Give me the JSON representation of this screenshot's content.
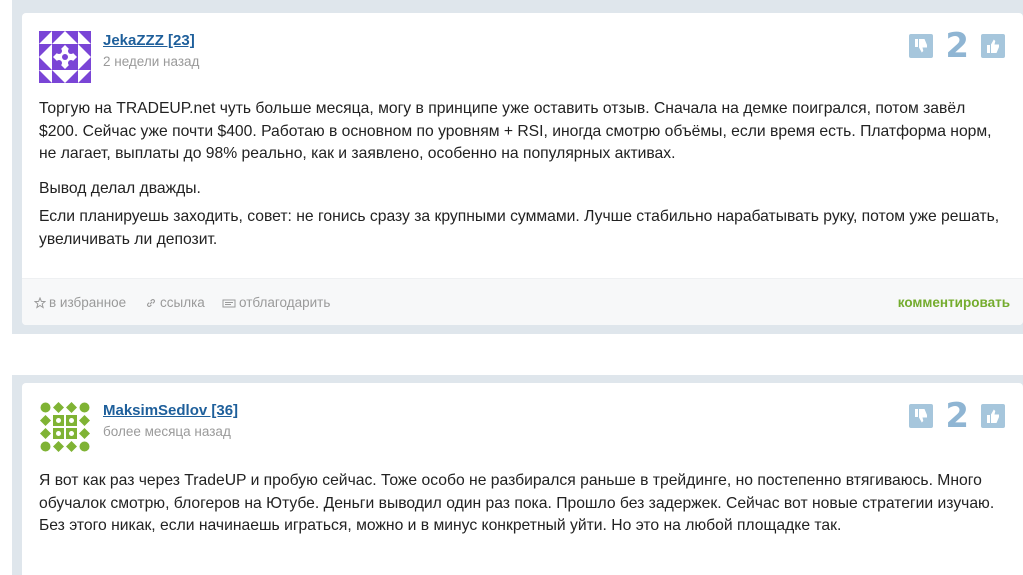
{
  "comments": [
    {
      "author": "JekaZZZ [23]",
      "date": "2 недели назад",
      "score": "2",
      "paragraphs": [
        "Торгую на TRADEUP.net чуть больше месяца, могу в принципе уже оставить отзыв. Сначала на демке поигрался, потом завёл $200. Сейчас уже почти $400. Работаю в основном по уровням + RSI, иногда смотрю объёмы, если время есть. Платформа норм, не лагает, выплаты до 98% реально, как и заявлено, особенно на популярных активах.",
        "Вывод делал дважды.",
        "Если планируешь заходить, совет: не гонись сразу за крупными суммами. Лучше стабильно нарабатывать руку, потом уже решать, увеличивать ли депозит."
      ],
      "footer": {
        "favorite": "в избранное",
        "link": "ссылка",
        "thank": "отблагодарить",
        "comment": "комментировать"
      },
      "avatar_color": "#7a45d6"
    },
    {
      "author": "MaksimSedlov [36]",
      "date": "более месяца назад",
      "score": "2",
      "paragraphs": [
        "Я вот как раз через TradeUP и пробую сейчас. Тоже особо не разбирался раньше в трейдинге, но постепенно втягиваюсь. Много обучалок смотрю, блогеров на Ютубе. Деньги выводил один раз пока. Прошло без задержек. Сейчас вот новые стратегии изучаю. Без этого никак, если начинаешь играться, можно и в минус конкретный уйти. Но это на любой площадке так."
      ],
      "avatar_color": "#7fb334"
    }
  ],
  "colors": {
    "link": "#1e5f9b",
    "comment_link": "#74ac2e",
    "vote_button": "#a6c6dc",
    "score": "#8fb5d3",
    "frame": "#dfe6ec"
  }
}
